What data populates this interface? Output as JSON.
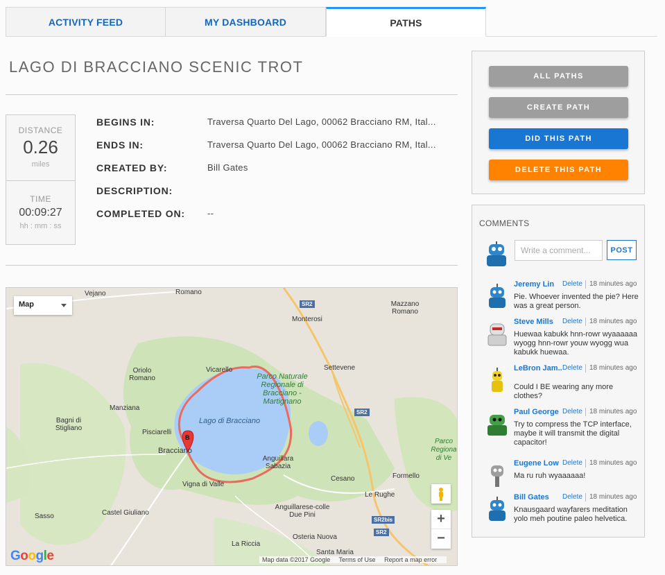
{
  "tabs": [
    {
      "label": "ACTIVITY FEED"
    },
    {
      "label": "MY DASHBOARD"
    },
    {
      "label": "PATHS"
    }
  ],
  "path": {
    "title": "LAGO DI BRACCIANO SCENIC TROT",
    "distance_label": "DISTANCE",
    "distance_value": "0.26",
    "distance_unit": "miles",
    "time_label": "TIME",
    "time_value": "00:09:27",
    "time_unit": "hh : mm : ss",
    "fields": [
      {
        "key": "BEGINS IN:",
        "value": "Traversa Quarto Del Lago, 00062 Bracciano RM, Ital..."
      },
      {
        "key": "ENDS IN:",
        "value": "Traversa Quarto Del Lago, 00062 Bracciano RM, Ital..."
      },
      {
        "key": "CREATED BY:",
        "value": "Bill Gates"
      },
      {
        "key": "DESCRIPTION:",
        "value": ""
      },
      {
        "key": "COMPLETED ON:",
        "value": "--"
      }
    ]
  },
  "map": {
    "type_label": "Map",
    "zoom_in": "+",
    "zoom_out": "−",
    "logo": "Google",
    "footer": [
      "Map data ©2017 Google",
      "Terms of Use",
      "Report a map error"
    ],
    "marker_label": "B",
    "labels": {
      "vejano": "Vejano",
      "romano": "Romano",
      "monterosi": "Monterosi",
      "mazzano": "Mazzano Romano",
      "oriolo": "Oriolo Romano",
      "vicarello": "Vicarello",
      "settevene": "Settevene",
      "park": "Parco Naturale Regionale di Bracciano - Martignano",
      "manziana": "Manziana",
      "bagni": "Bagni di Stigliano",
      "lake": "Lago di Bracciano",
      "pisciarelli": "Pisciarelli",
      "bracciano": "Bracciano",
      "anguillara": "Anguillara Sabazia",
      "vigna": "Vigna di Valle",
      "cesano": "Cesano",
      "formello": "Formello",
      "castel": "Castel Giuliano",
      "sasso": "Sasso",
      "anguillara_pini": "Anguillarese-colle Due Pini",
      "le_rughe": "Le Rughe",
      "osteria": "Osteria Nuova",
      "santa_maria": "Santa Maria",
      "la_riccia": "La Riccia",
      "parco_ve": "Parco Regiona di Ve",
      "sr2": "SR2",
      "sr2bis": "SR2bis"
    }
  },
  "actions": {
    "all_paths": "ALL PATHS",
    "create_path": "CREATE PATH",
    "did_path": "DID THIS PATH",
    "delete_path": "DELETE THIS PATH"
  },
  "comments": {
    "heading": "COMMENTS",
    "placeholder": "Write a comment...",
    "post_label": "POST",
    "delete_label": "Delete",
    "items": [
      {
        "name": "Jeremy Lin",
        "time": "18 minutes ago",
        "text": "Pie. Whoever invented the pie? Here was a great person.",
        "avatar": "blue-robot"
      },
      {
        "name": "Steve Mills",
        "time": "18 minutes ago",
        "text": "Huewaa kabukk hnn-rowr wyaaaaaa wyogg hnn-rowr youw wyogg wua kabukk huewaa.",
        "avatar": "white-robot"
      },
      {
        "name": "LeBron Jam...",
        "time": "18 minutes ago",
        "text": "Could I BE wearing any more clothes?",
        "avatar": "yellow-robot"
      },
      {
        "name": "Paul George",
        "time": "18 minutes ago",
        "text": "Try to compress the TCP interface, maybe it will transmit the digital capacitor!",
        "avatar": "green-robot"
      },
      {
        "name": "Eugene Low",
        "time": "18 minutes ago",
        "text": "Ma ru ruh wyaaaaaa!",
        "avatar": "gray-robot"
      },
      {
        "name": "Bill Gates",
        "time": "18 minutes ago",
        "text": "Knausgaard wayfarers meditation yolo meh poutine paleo helvetica.",
        "avatar": "blue-robot"
      }
    ]
  }
}
